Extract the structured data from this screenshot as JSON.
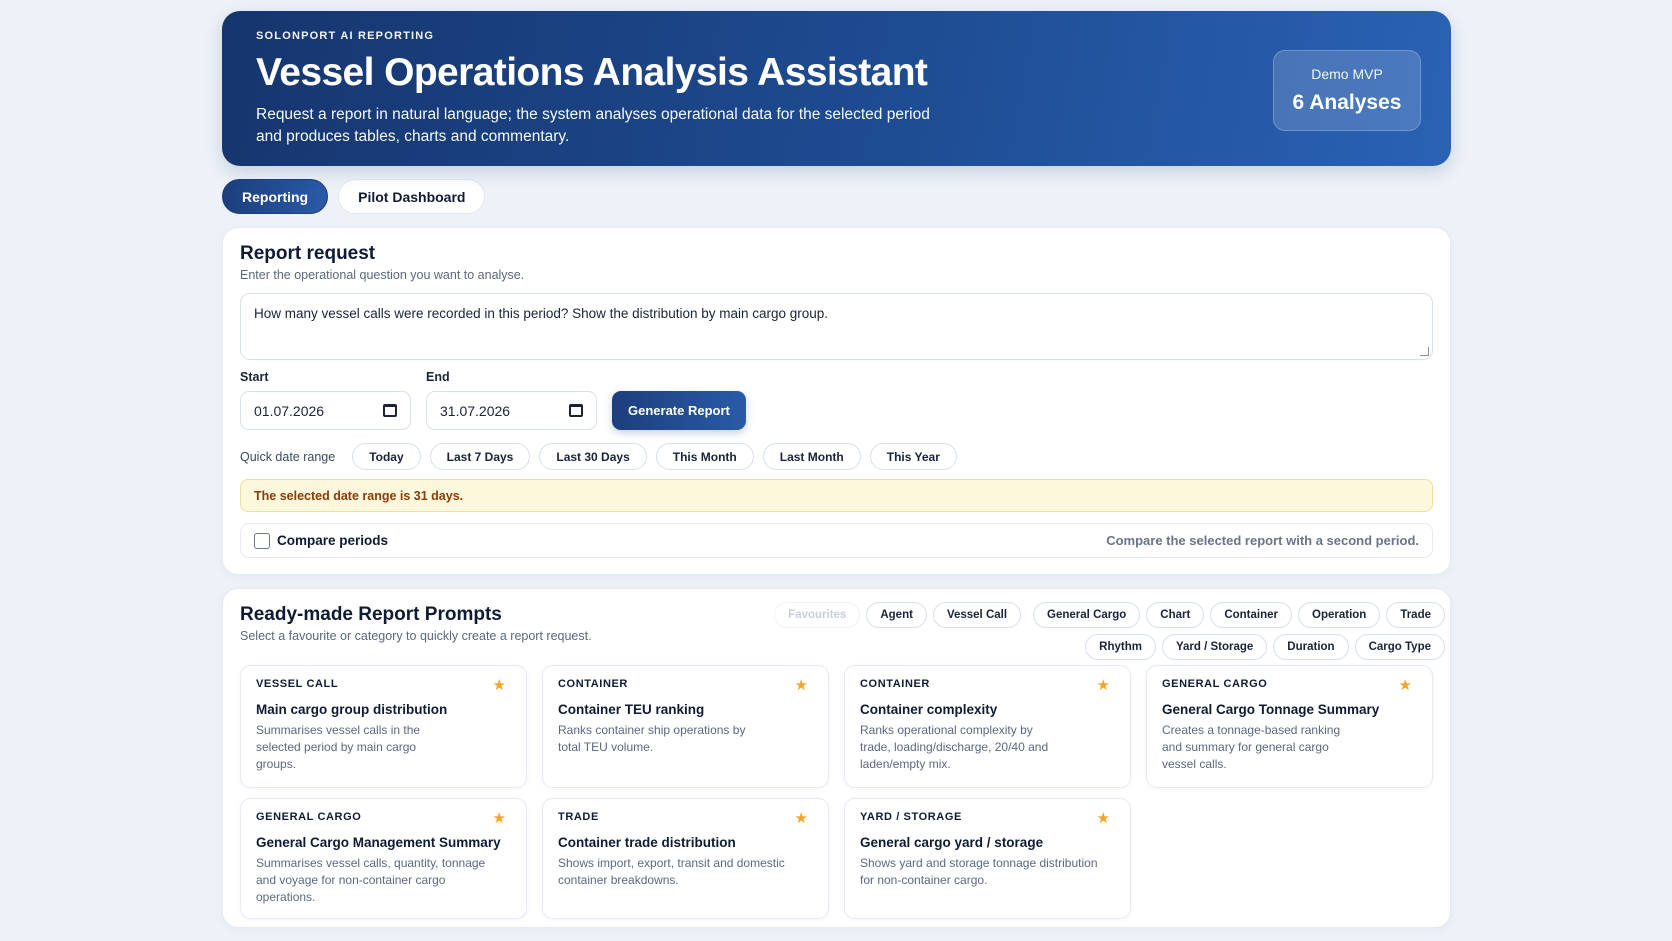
{
  "hero": {
    "eyebrow": "SOLONPORT AI REPORTING",
    "title": "Vessel Operations Analysis Assistant",
    "description": "Request a report in natural language; the system analyses operational data for the selected period and produces tables, charts and commentary.",
    "badge_label": "Demo MVP",
    "badge_value": "6 Analyses"
  },
  "tabs": [
    {
      "label": "Reporting",
      "active": true
    },
    {
      "label": "Pilot Dashboard",
      "active": false
    }
  ],
  "request": {
    "title": "Report request",
    "subtitle": "Enter the operational question you want to analyse.",
    "question": "How many vessel calls were recorded in this period? Show the distribution by main cargo group.",
    "start_label": "Start",
    "start_value": "01.07.2026",
    "end_label": "End",
    "end_value": "31.07.2026",
    "generate_label": "Generate Report",
    "quick_label": "Quick date range",
    "quick_ranges": [
      "Today",
      "Last 7 Days",
      "Last 30 Days",
      "This Month",
      "Last Month",
      "This Year"
    ],
    "range_notice": "The selected date range is 31 days.",
    "compare_label": "Compare periods",
    "compare_hint": "Compare the selected report with a second period."
  },
  "prompts": {
    "title": "Ready-made Report Prompts",
    "subtitle": "Select a favourite or category to quickly create a report request.",
    "categories_row1": [
      "Favourites",
      "Agent",
      "Vessel Call",
      "General Cargo",
      "Chart",
      "Container",
      "Operation",
      "Trade"
    ],
    "categories_row2": [
      "Rhythm",
      "Yard / Storage",
      "Duration",
      "Cargo Type"
    ],
    "cards": [
      {
        "tag": "VESSEL CALL",
        "name": "Main cargo group distribution",
        "desc": "Summarises vessel calls in the selected period by main cargo groups."
      },
      {
        "tag": "CONTAINER",
        "name": "Container TEU ranking",
        "desc": "Ranks container ship operations by total TEU volume."
      },
      {
        "tag": "CONTAINER",
        "name": "Container complexity",
        "desc": "Ranks operational complexity by trade, loading/discharge, 20/40 and laden/empty mix."
      },
      {
        "tag": "GENERAL CARGO",
        "name": "General Cargo Tonnage Summary",
        "desc": "Creates a tonnage-based ranking and summary for general cargo vessel calls."
      },
      {
        "tag": "GENERAL CARGO",
        "name": "General Cargo Management Summary",
        "desc": "Summarises vessel calls, quantity, tonnage and voyage for non-container cargo operations."
      },
      {
        "tag": "TRADE",
        "name": "Container trade distribution",
        "desc": "Shows import, export, transit and domestic container breakdowns."
      },
      {
        "tag": "YARD / STORAGE",
        "name": "General cargo yard / storage",
        "desc": "Shows yard and storage tonnage distribution for non-container cargo."
      }
    ]
  },
  "colors": {
    "primary": "#1c3f7c",
    "star": "#f2a526",
    "notice_bg": "#fdf7dc",
    "notice_text": "#8a3b06"
  },
  "icons": {
    "date": "calendar-icon",
    "favourite": "star-icon"
  }
}
